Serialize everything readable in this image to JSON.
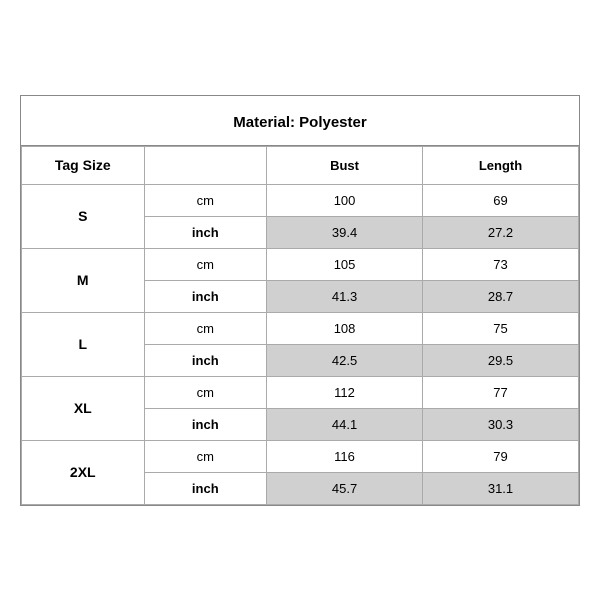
{
  "title": "Material: Polyester",
  "columns": {
    "tag_size": "Tag Size",
    "bust": "Bust",
    "length": "Length"
  },
  "sizes": [
    {
      "tag": "S",
      "cm": {
        "bust": "100",
        "length": "69"
      },
      "inch": {
        "bust": "39.4",
        "length": "27.2"
      }
    },
    {
      "tag": "M",
      "cm": {
        "bust": "105",
        "length": "73"
      },
      "inch": {
        "bust": "41.3",
        "length": "28.7"
      }
    },
    {
      "tag": "L",
      "cm": {
        "bust": "108",
        "length": "75"
      },
      "inch": {
        "bust": "42.5",
        "length": "29.5"
      }
    },
    {
      "tag": "XL",
      "cm": {
        "bust": "112",
        "length": "77"
      },
      "inch": {
        "bust": "44.1",
        "length": "30.3"
      }
    },
    {
      "tag": "2XL",
      "cm": {
        "bust": "116",
        "length": "79"
      },
      "inch": {
        "bust": "45.7",
        "length": "31.1"
      }
    }
  ],
  "unit_labels": {
    "cm": "cm",
    "inch": "inch"
  }
}
